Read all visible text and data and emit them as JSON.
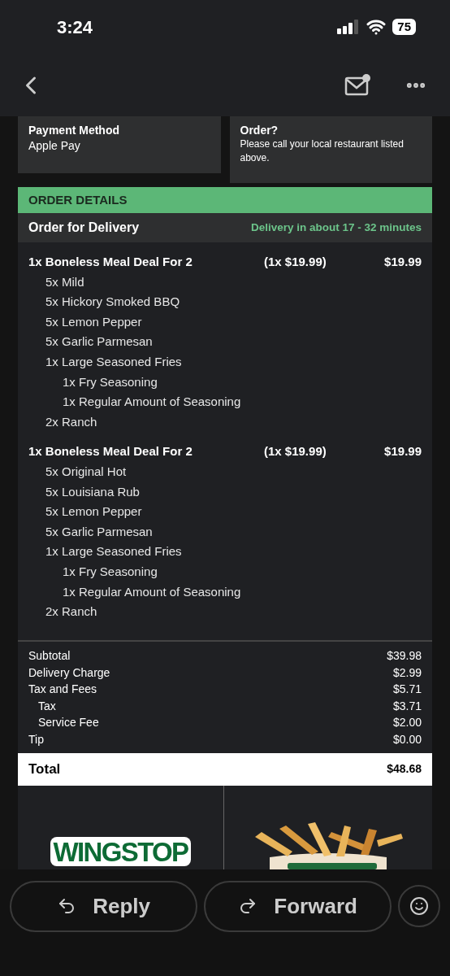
{
  "status_bar": {
    "time": "3:24",
    "battery": "75"
  },
  "cards": [
    {
      "title": "Payment Method",
      "body": "Apple Pay"
    },
    {
      "title": "Order?",
      "body": "Please call your local restaurant listed above."
    }
  ],
  "order_details": {
    "heading": "ORDER DETAILS",
    "type": "Order for Delivery",
    "eta": "Delivery in about 17 - 32 minutes",
    "items": [
      {
        "name": "1x Boneless Meal Deal For 2",
        "unit": "(1x $19.99)",
        "price": "$19.99",
        "modifiers": [
          {
            "label": "5x Mild"
          },
          {
            "label": "5x Hickory Smoked BBQ"
          },
          {
            "label": "5x Lemon Pepper"
          },
          {
            "label": "5x Garlic Parmesan"
          },
          {
            "label": "1x Large Seasoned Fries",
            "children": [
              {
                "label": "1x Fry Seasoning"
              },
              {
                "label": "1x Regular Amount of Seasoning"
              }
            ]
          },
          {
            "label": "2x Ranch"
          }
        ]
      },
      {
        "name": "1x Boneless Meal Deal For 2",
        "unit": "(1x $19.99)",
        "price": "$19.99",
        "modifiers": [
          {
            "label": "5x Original Hot"
          },
          {
            "label": "5x Louisiana Rub"
          },
          {
            "label": "5x Lemon Pepper"
          },
          {
            "label": "5x Garlic Parmesan"
          },
          {
            "label": "1x Large Seasoned Fries",
            "children": [
              {
                "label": "1x Fry Seasoning"
              },
              {
                "label": "1x Regular Amount of Seasoning"
              }
            ]
          },
          {
            "label": "2x Ranch"
          }
        ]
      }
    ],
    "totals": [
      {
        "label": "Subtotal",
        "value": "$39.98",
        "kind": "main"
      },
      {
        "label": "Delivery Charge",
        "value": "$2.99",
        "kind": "main"
      },
      {
        "label": "Tax and Fees",
        "value": "$5.71",
        "kind": "main"
      },
      {
        "label": "Tax",
        "value": "$3.71",
        "kind": "sub"
      },
      {
        "label": "Service Fee",
        "value": "$2.00",
        "kind": "sub"
      },
      {
        "label": "Tip",
        "value": "$0.00",
        "kind": "main"
      },
      {
        "label": "Total",
        "value": "$48.68",
        "kind": "grand"
      }
    ]
  },
  "promo": {
    "logo": "WINGSTOP"
  },
  "actions": [
    {
      "label": "Reply",
      "kind": "reply"
    },
    {
      "label": "Forward",
      "kind": "forward"
    }
  ]
}
